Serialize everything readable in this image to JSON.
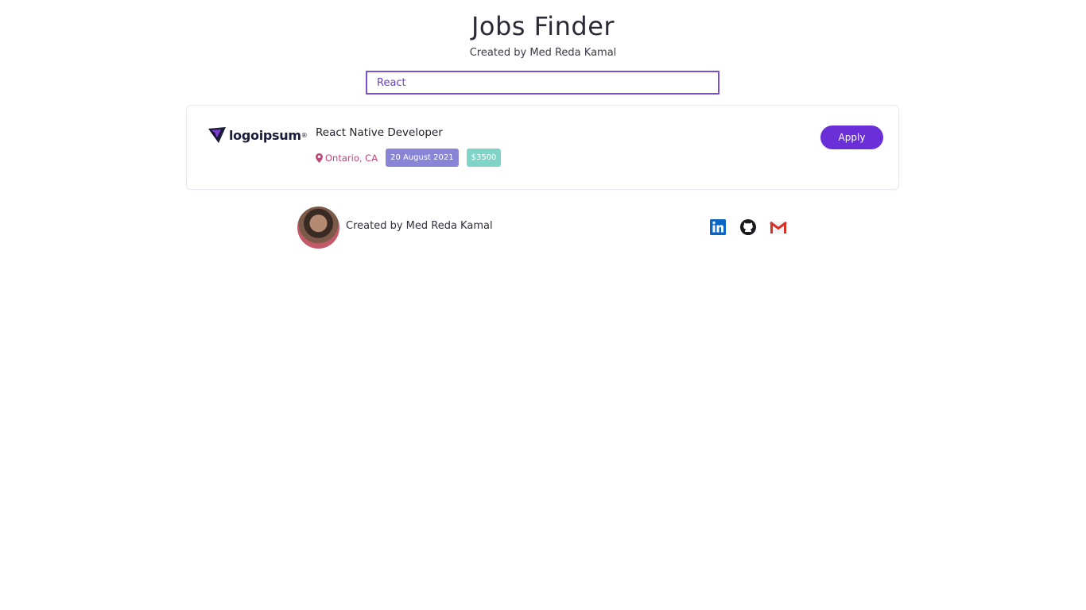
{
  "header": {
    "title": "Jobs Finder",
    "subtitle": "Created by Med Reda Kamal"
  },
  "search": {
    "value": "React"
  },
  "job": {
    "logo_text": "logoipsum",
    "title": "React Native Developer",
    "location": "Ontario, CA",
    "date": "20 August 2021",
    "salary": "$3500",
    "apply_label": "Apply"
  },
  "footer": {
    "text": "Created by Med Reda Kamal",
    "social_icons": [
      "linkedin-icon",
      "github-icon",
      "gmail-icon"
    ]
  },
  "colors": {
    "accent": "#6a2fd6",
    "location": "#c0467b",
    "date_tag": "#8a84d6",
    "salary_tag": "#7fd3c7"
  }
}
